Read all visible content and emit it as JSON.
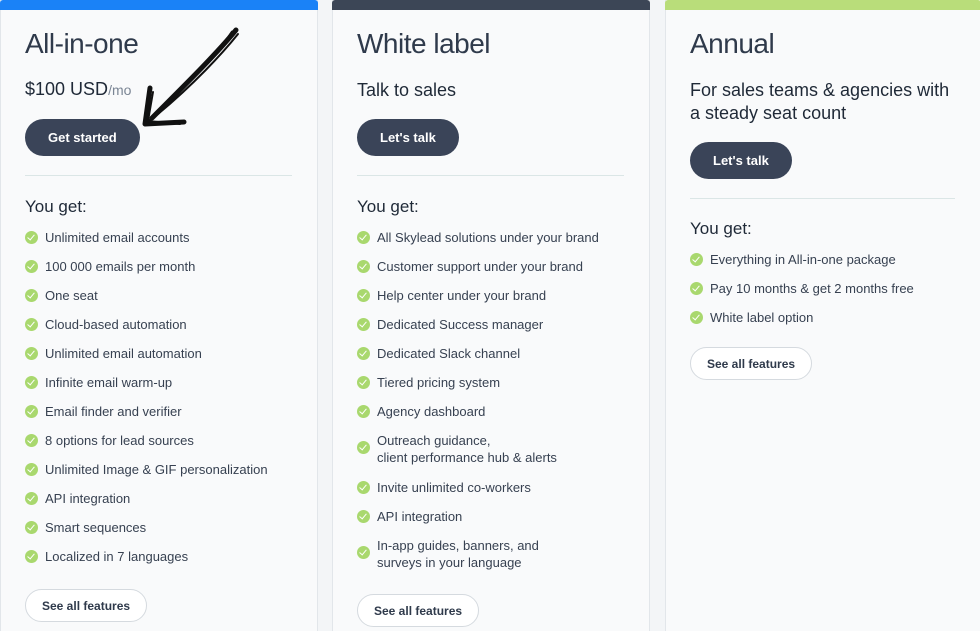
{
  "colors": {
    "allinone_bar": "#1a82f7",
    "white_label_bar": "#3c4656",
    "annual_bar": "#b9dd7a",
    "cta_background": "#3a4458",
    "check": "#a9d86e"
  },
  "plans": {
    "allinone": {
      "title": "All-in-one",
      "price": "$100 USD",
      "price_period": "/mo",
      "cta": "Get started",
      "you_get": "You get:",
      "features": [
        "Unlimited email accounts",
        "100 000 emails per month",
        "One seat",
        "Cloud-based automation",
        "Unlimited email automation",
        "Infinite email warm-up",
        "Email finder and verifier",
        "8 options for lead sources",
        "Unlimited Image & GIF personalization",
        "API integration",
        "Smart sequences",
        "Localized in 7 languages"
      ],
      "see_all": "See all features"
    },
    "white_label": {
      "title": "White label",
      "subtitle": "Talk to sales",
      "cta": "Let's talk",
      "you_get": "You get:",
      "features": [
        "All Skylead solutions under your brand",
        "Customer support under your brand",
        "Help center under your brand",
        "Dedicated Success manager",
        "Dedicated Slack channel",
        "Tiered pricing system",
        "Agency dashboard",
        "Outreach guidance,\nclient performance hub & alerts",
        "Invite unlimited co-workers",
        "API integration",
        "In-app guides, banners, and\nsurveys in your language"
      ],
      "see_all": "See all features"
    },
    "annual": {
      "title": "Annual",
      "subtitle": "For sales teams & agencies with a steady seat count",
      "cta": "Let's talk",
      "you_get": "You get:",
      "features": [
        "Everything in All-in-one package",
        "Pay 10 months & get 2 months free",
        "White label option"
      ],
      "see_all": "See all features"
    }
  },
  "annotation": {
    "icon": "hand-drawn-arrow-icon"
  }
}
